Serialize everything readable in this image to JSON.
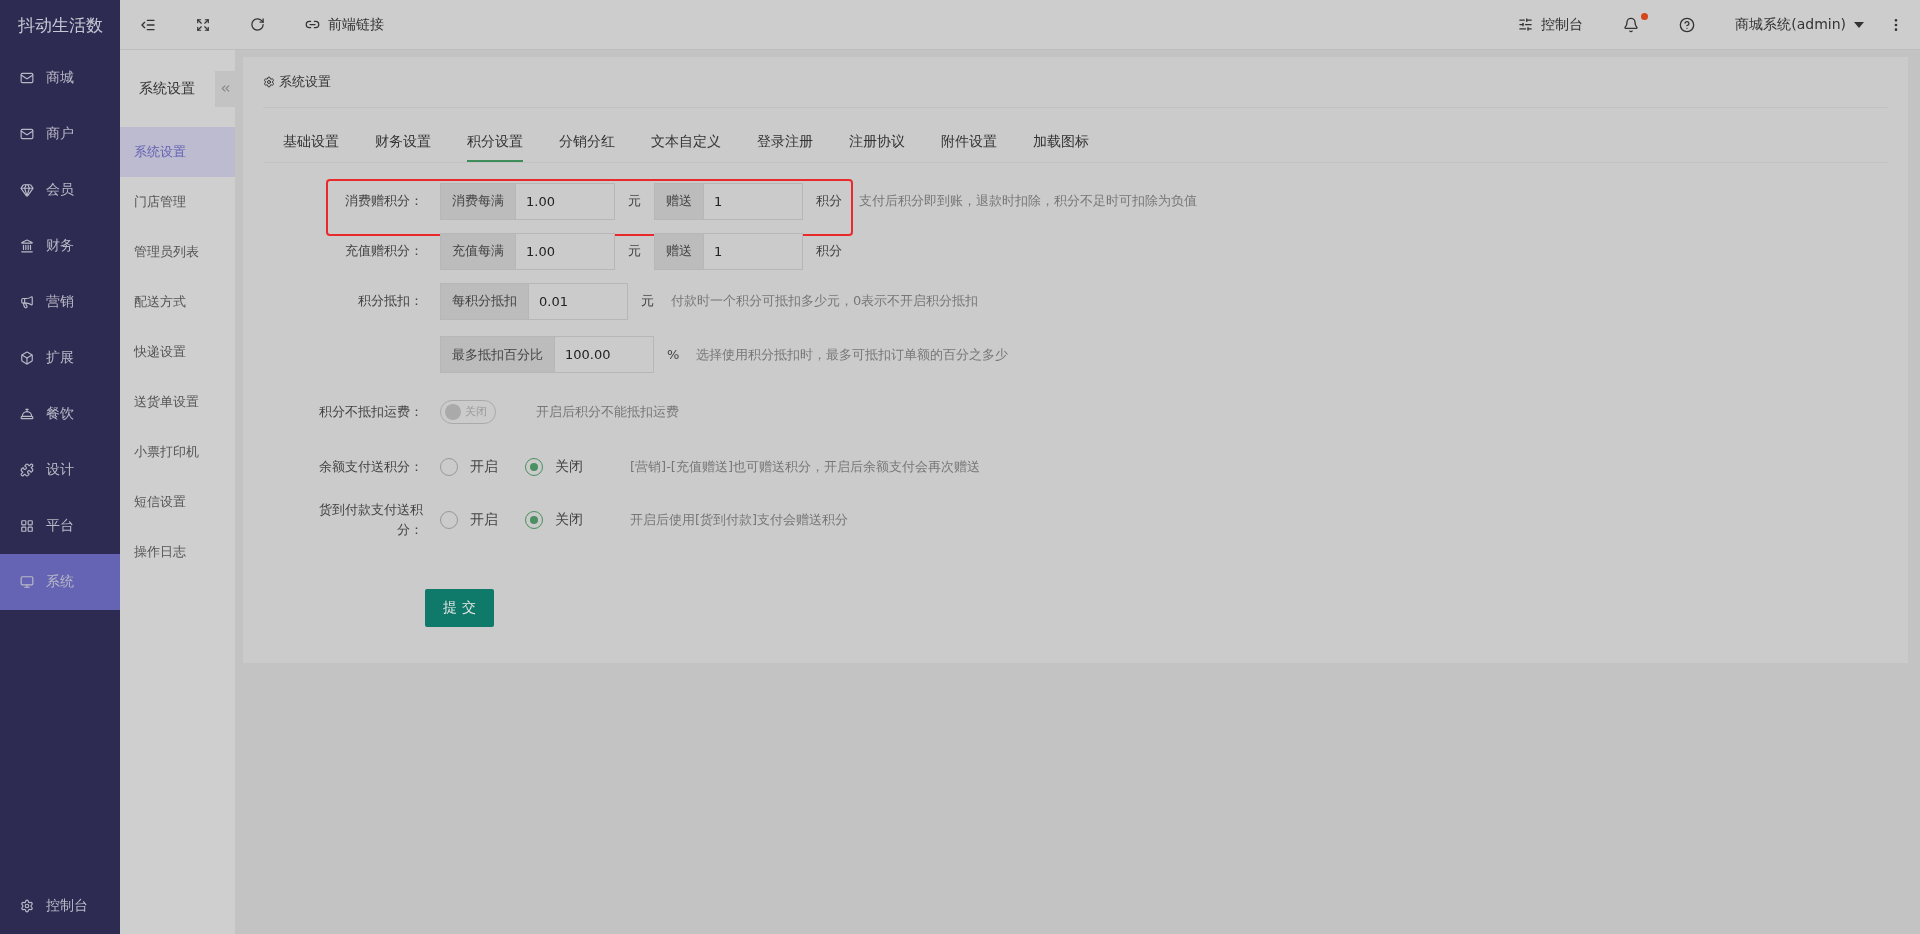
{
  "sidebar": {
    "logo": "抖动生活数",
    "footer": "控制台",
    "items": [
      {
        "label": "商城",
        "selected": false
      },
      {
        "label": "商户",
        "selected": false
      },
      {
        "label": "会员",
        "selected": false
      },
      {
        "label": "财务",
        "selected": false
      },
      {
        "label": "营销",
        "selected": false
      },
      {
        "label": "扩展",
        "selected": false
      },
      {
        "label": "餐饮",
        "selected": false
      },
      {
        "label": "设计",
        "selected": false
      },
      {
        "label": "平台",
        "selected": false
      },
      {
        "label": "系统",
        "selected": true
      }
    ]
  },
  "topbar": {
    "link": "前端链接",
    "console": "控制台",
    "unread": true,
    "user": "商城系统(admin)"
  },
  "subnav": {
    "title": "系统设置",
    "items": [
      {
        "label": "系统设置",
        "selected": true
      },
      {
        "label": "门店管理",
        "selected": false
      },
      {
        "label": "管理员列表",
        "selected": false
      },
      {
        "label": "配送方式",
        "selected": false
      },
      {
        "label": "快递设置",
        "selected": false
      },
      {
        "label": "送货单设置",
        "selected": false
      },
      {
        "label": "小票打印机",
        "selected": false
      },
      {
        "label": "短信设置",
        "selected": false
      },
      {
        "label": "操作日志",
        "selected": false
      }
    ]
  },
  "card": {
    "title": "系统设置",
    "tabs": [
      {
        "label": "基础设置",
        "selected": false
      },
      {
        "label": "财务设置",
        "selected": false
      },
      {
        "label": "积分设置",
        "selected": true
      },
      {
        "label": "分销分红",
        "selected": false
      },
      {
        "label": "文本自定义",
        "selected": false
      },
      {
        "label": "登录注册",
        "selected": false
      },
      {
        "label": "注册协议",
        "selected": false
      },
      {
        "label": "附件设置",
        "selected": false
      },
      {
        "label": "加载图标",
        "selected": false
      }
    ],
    "fields": [
      {
        "kind": "pair",
        "highlighted": true,
        "label": "消费赠积分：",
        "groups": [
          {
            "prefix": "消费每满",
            "value": "1.00",
            "unit": "元"
          },
          {
            "prefix": "赠送",
            "value": "1",
            "unit": "积分"
          }
        ],
        "hint": "支付后积分即到账，退款时扣除，积分不足时可扣除为负值"
      },
      {
        "kind": "pair",
        "highlighted": false,
        "label": "充值赠积分：",
        "groups": [
          {
            "prefix": "充值每满",
            "value": "1.00",
            "unit": "元"
          },
          {
            "prefix": "赠送",
            "value": "1",
            "unit": "积分"
          }
        ]
      },
      {
        "kind": "pair",
        "highlighted": false,
        "label": "积分抵扣：",
        "groups": [
          {
            "prefix": "每积分抵扣",
            "value": "0.01",
            "unit": "元"
          }
        ],
        "hint": "付款时一个积分可抵扣多少元，0表示不开启积分抵扣"
      },
      {
        "kind": "pair",
        "highlighted": false,
        "groups": [
          {
            "prefix": "最多抵扣百分比",
            "value": "100.00",
            "unit": "%"
          }
        ],
        "hint": "选择使用积分抵扣时，最多可抵扣订单额的百分之多少"
      },
      {
        "kind": "switch",
        "highlighted": false,
        "label": "积分不抵扣运费：",
        "on": false,
        "text": "关闭",
        "hint": "开启后积分不能抵扣运费"
      },
      {
        "kind": "radio",
        "highlighted": false,
        "label": "余额支付送积分：",
        "options": [
          {
            "label": "开启",
            "selected": false
          },
          {
            "label": "关闭",
            "selected": true
          }
        ],
        "hint": "[营销]-[充值赠送]也可赠送积分，开启后余额支付会再次赠送"
      },
      {
        "kind": "radio",
        "highlighted": false,
        "label": "货到付款支付送积分：",
        "options": [
          {
            "label": "开启",
            "selected": false
          },
          {
            "label": "关闭",
            "selected": true
          }
        ],
        "hint": "开启后使用[货到付款]支付会赠送积分"
      }
    ],
    "submit": "提 交"
  }
}
